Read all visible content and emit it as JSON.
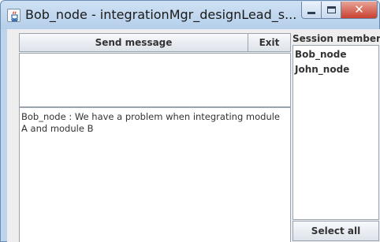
{
  "window": {
    "title": "Bob_node - integrationMgr_designLead_s..."
  },
  "toolbar": {
    "send_label": "Send message",
    "exit_label": "Exit"
  },
  "message_input": {
    "value": ""
  },
  "chat_log": {
    "text": "Bob_node : We have a problem when integrating module A and module B"
  },
  "members": {
    "title": "Session members",
    "items": [
      "Bob_node",
      "John_node"
    ],
    "select_all_label": "Select all"
  },
  "icons": {
    "app": "java-app-icon",
    "minimize": "minimize-icon",
    "maximize": "maximize-icon",
    "close": "close-icon"
  }
}
